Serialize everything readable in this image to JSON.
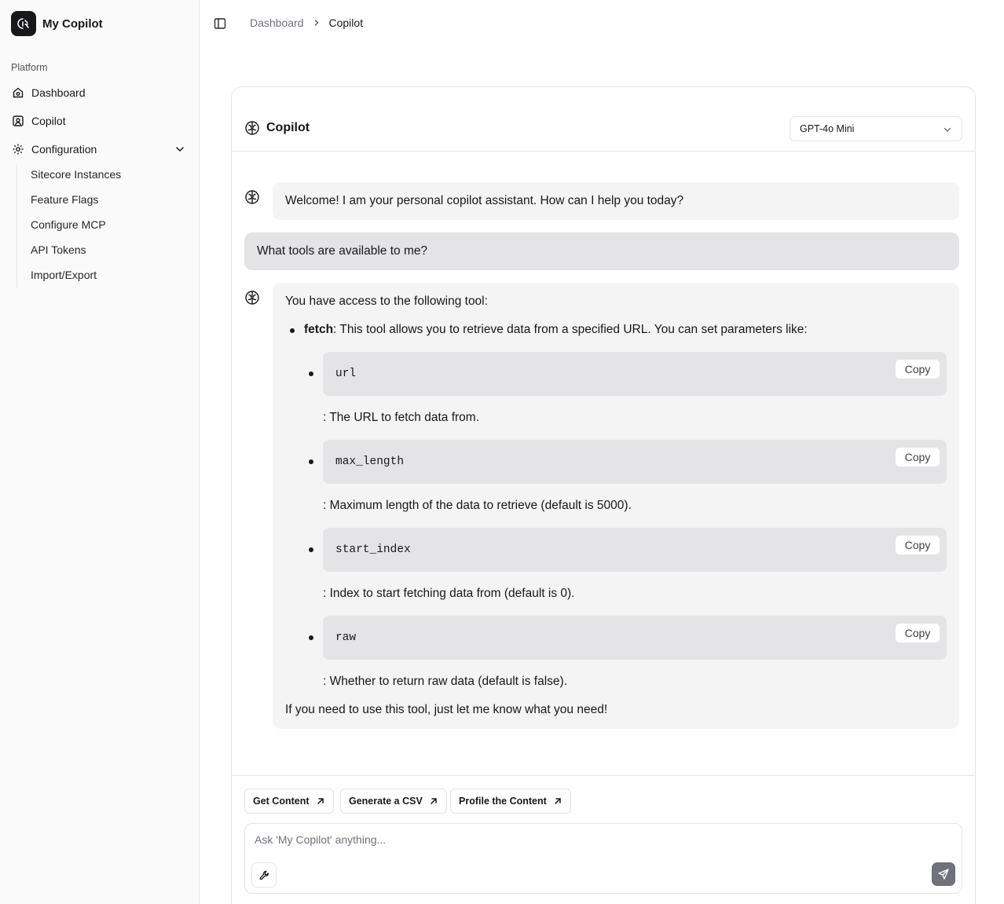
{
  "app": {
    "name": "My Copilot"
  },
  "sidebar": {
    "section_label": "Platform",
    "items": [
      {
        "label": "Dashboard",
        "icon": "home-icon"
      },
      {
        "label": "Copilot",
        "icon": "bot-icon"
      },
      {
        "label": "Configuration",
        "icon": "gear-icon"
      }
    ],
    "sub_items": [
      {
        "label": "Sitecore Instances"
      },
      {
        "label": "Feature Flags"
      },
      {
        "label": "Configure MCP"
      },
      {
        "label": "API Tokens"
      },
      {
        "label": "Import/Export"
      }
    ]
  },
  "breadcrumb": {
    "parent": "Dashboard",
    "current": "Copilot"
  },
  "card": {
    "title": "Copilot",
    "model": "GPT-4o Mini"
  },
  "messages": {
    "welcome": "Welcome! I am your personal copilot assistant. How can I help you today?",
    "user_question": "What tools are available to me?",
    "reply_intro": "You have access to the following tool:",
    "tool_name": "fetch",
    "tool_desc": ": This tool allows you to retrieve data from a specified URL. You can set parameters like:",
    "params": [
      {
        "code": "url",
        "desc": ": The URL to fetch data from."
      },
      {
        "code": "max_length",
        "desc": ": Maximum length of the data to retrieve (default is 5000)."
      },
      {
        "code": "start_index",
        "desc": ": Index to start fetching data from (default is 0)."
      },
      {
        "code": "raw",
        "desc": ": Whether to return raw data (default is false)."
      }
    ],
    "copy_label": "Copy",
    "reply_outro": "If you need to use this tool, just let me know what you need!"
  },
  "suggestions": [
    {
      "label": "Get Content"
    },
    {
      "label": "Generate a CSV"
    },
    {
      "label": "Profile the Content"
    }
  ],
  "composer": {
    "placeholder": "Ask 'My Copilot' anything..."
  },
  "colors": {
    "accent": "#18181b",
    "bubble": "#f4f4f5",
    "user_bubble": "#e4e4e7",
    "send_button": "#71717a"
  }
}
